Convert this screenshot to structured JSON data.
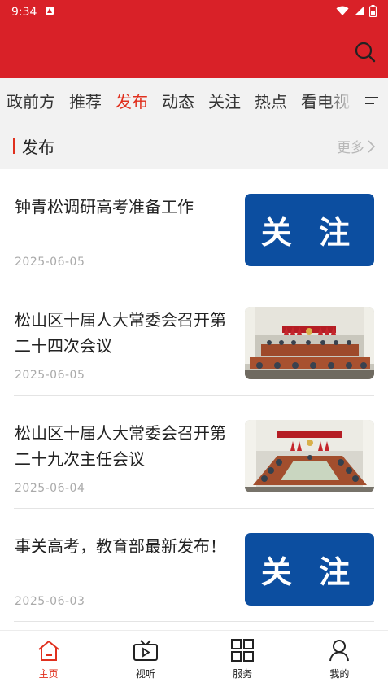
{
  "status_bar": {
    "time": "9:34"
  },
  "tabs": [
    {
      "label": "政前方",
      "active": false
    },
    {
      "label": "推荐",
      "active": false
    },
    {
      "label": "发布",
      "active": true
    },
    {
      "label": "动态",
      "active": false
    },
    {
      "label": "关注",
      "active": false
    },
    {
      "label": "热点",
      "active": false
    },
    {
      "label": "看电视",
      "active": false
    }
  ],
  "section": {
    "title": "发布",
    "more": "更多"
  },
  "articles": [
    {
      "title": "钟青松调研高考准备工作",
      "date": "2025-06-05",
      "thumb": "follow",
      "thumb_text": "关 注"
    },
    {
      "title": "松山区十届人大常委会召开第二十四次会议",
      "date": "2025-06-05",
      "thumb": "photo-meeting-1"
    },
    {
      "title": "松山区十届人大常委会召开第二十九次主任会议",
      "date": "2025-06-04",
      "thumb": "photo-meeting-2"
    },
    {
      "title": "事关高考，教育部最新发布！",
      "date": "2025-06-03",
      "thumb": "follow",
      "thumb_text": "关 注"
    }
  ],
  "bottom_nav": [
    {
      "label": "主页",
      "icon": "home-icon",
      "active": true
    },
    {
      "label": "视听",
      "icon": "tv-icon",
      "active": false
    },
    {
      "label": "服务",
      "icon": "grid-icon",
      "active": false
    },
    {
      "label": "我的",
      "icon": "user-icon",
      "active": false
    }
  ],
  "colors": {
    "brand_red": "#d92128",
    "active_tab": "#e0301e",
    "follow_blue": "#0c4ea0"
  }
}
